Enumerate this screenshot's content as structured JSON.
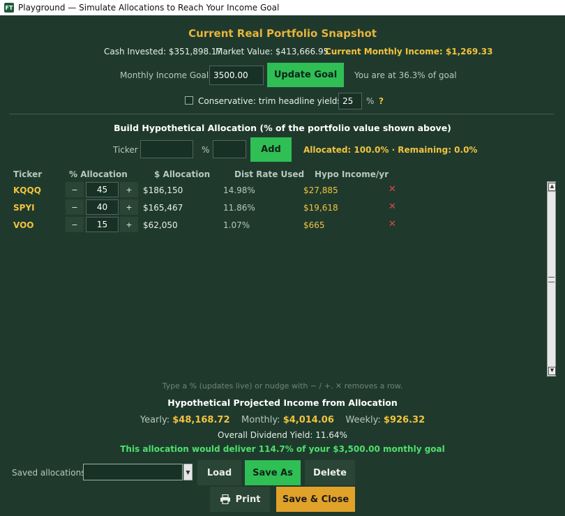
{
  "window": {
    "icon_text": "FT",
    "title": "Playground — Simulate Allocations to Reach Your Income Goal"
  },
  "snapshot": {
    "title": "Current Real Portfolio Snapshot",
    "cash_invested": "Cash Invested: $351,898.17",
    "market_value": "Market Value: $413,666.95",
    "monthly_income": "Current Monthly Income: $1,269.33",
    "goal_label": "Monthly Income Goal: $",
    "goal_value": "3500.00",
    "update_button": "Update Goal",
    "progress_text": "You are at 36.3% of goal",
    "conservative_label": "Conservative: trim headline yields by",
    "conservative_checked": false,
    "trim_value": "25",
    "trim_unit": "%",
    "help": "?"
  },
  "builder": {
    "title": "Build Hypothetical Allocation  (% of the portfolio value shown above)",
    "ticker_label": "Ticker",
    "pct_label": "%",
    "add_button": "Add",
    "allocated_text": "Allocated: 100.0%  ·  Remaining: 0.0%"
  },
  "table": {
    "headers": [
      "Ticker",
      "% Allocation",
      "$ Allocation",
      "Dist Rate Used",
      "Hypo Income/yr"
    ],
    "minus": "−",
    "plus": "+",
    "remove": "✕",
    "rows": [
      {
        "ticker": "KQQQ",
        "pct": "45",
        "dollars": "$186,150",
        "rate": "14.98%",
        "income": "$27,885"
      },
      {
        "ticker": "SPYI",
        "pct": "40",
        "dollars": "$165,467",
        "rate": "11.86%",
        "income": "$19,618"
      },
      {
        "ticker": "VOO",
        "pct": "15",
        "dollars": "$62,050",
        "rate": "1.07%",
        "income": "$665"
      }
    ],
    "hint": "Type a % (updates live) or nudge with − / +.  ✕ removes a row."
  },
  "projection": {
    "title": "Hypothetical Projected Income from Allocation",
    "yearly_label": "Yearly:",
    "yearly_value": "$48,168.72",
    "monthly_label": "Monthly:",
    "monthly_value": "$4,014.06",
    "weekly_label": "Weekly:",
    "weekly_value": "$926.32",
    "yield_text": "Overall Dividend Yield: 11.64%",
    "delivery_text": "This allocation would deliver 114.7% of your $3,500.00 monthly goal"
  },
  "saved": {
    "label": "Saved allocations:",
    "selected": "",
    "load": "Load",
    "save_as": "Save As",
    "delete": "Delete",
    "print": "Print",
    "save_close": "Save & Close"
  },
  "colors": {
    "background": "#1f3a2d",
    "gold": "#f2c33e",
    "green": "#2fbf55",
    "remove": "#e04848"
  }
}
